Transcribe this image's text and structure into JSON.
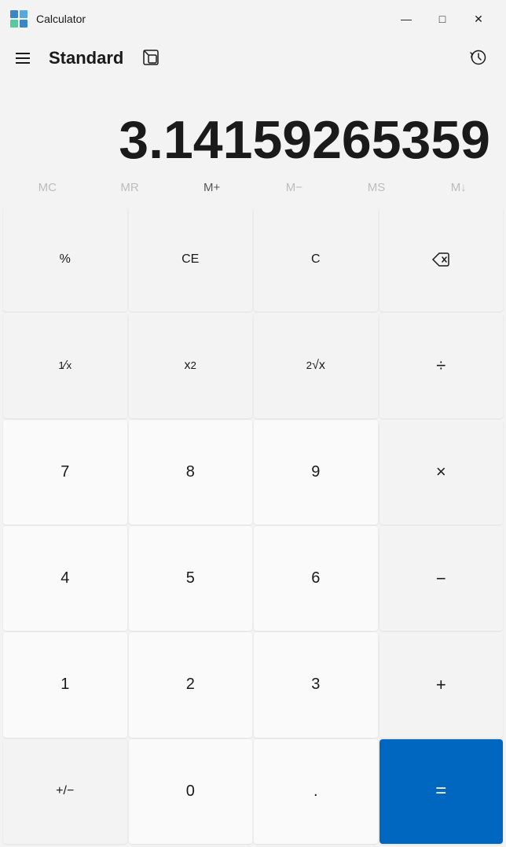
{
  "titleBar": {
    "appName": "Calculator",
    "minimizeLabel": "—",
    "maximizeLabel": "□",
    "closeLabel": "✕"
  },
  "header": {
    "title": "Standard",
    "hamburgerLabel": "Menu",
    "historyLabel": "History",
    "compactLabel": "Compact overlay"
  },
  "display": {
    "value": "3.14159265359"
  },
  "memory": {
    "buttons": [
      "MC",
      "MR",
      "M+",
      "M−",
      "MS",
      "M↓"
    ]
  },
  "buttons": [
    {
      "label": "%",
      "type": "special"
    },
    {
      "label": "CE",
      "type": "special"
    },
    {
      "label": "C",
      "type": "special"
    },
    {
      "label": "⌫",
      "type": "special"
    },
    {
      "label": "¹∕ₓ",
      "type": "special"
    },
    {
      "label": "x²",
      "type": "special"
    },
    {
      "label": "²√x",
      "type": "special"
    },
    {
      "label": "÷",
      "type": "operator"
    },
    {
      "label": "7",
      "type": "number"
    },
    {
      "label": "8",
      "type": "number"
    },
    {
      "label": "9",
      "type": "number"
    },
    {
      "label": "×",
      "type": "operator"
    },
    {
      "label": "4",
      "type": "number"
    },
    {
      "label": "5",
      "type": "number"
    },
    {
      "label": "6",
      "type": "number"
    },
    {
      "label": "−",
      "type": "operator"
    },
    {
      "label": "1",
      "type": "number"
    },
    {
      "label": "2",
      "type": "number"
    },
    {
      "label": "3",
      "type": "number"
    },
    {
      "label": "+",
      "type": "operator"
    },
    {
      "label": "+/−",
      "type": "special"
    },
    {
      "label": "0",
      "type": "number"
    },
    {
      "label": ".",
      "type": "number"
    },
    {
      "label": "=",
      "type": "equals"
    }
  ]
}
